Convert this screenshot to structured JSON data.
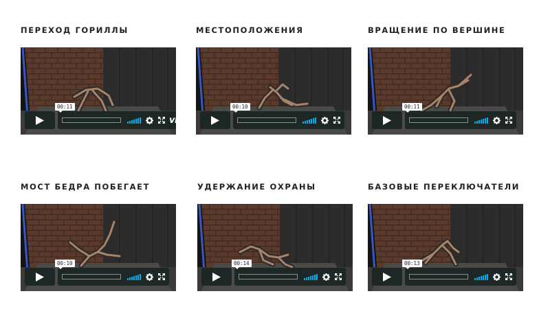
{
  "videos": [
    {
      "title": "ПЕРЕХОД ГОРИЛЛЫ",
      "time": "00:11",
      "brand": "vimeo"
    },
    {
      "title": "МЕСТОПОЛОЖЕНИЯ",
      "time": "00:10"
    },
    {
      "title": "ВРАЩЕНИЕ ПО ВЕРШИНЕ",
      "time": "00:11"
    },
    {
      "title": "МОСТ БЕДРА ПОБЕГАЕТ",
      "time": "00:10"
    },
    {
      "title": "УДЕРЖАНИЕ ОХРАНЫ",
      "time": "00:14"
    },
    {
      "title": "БАЗОВЫЕ ПЕРЕКЛЮЧАТЕЛИ",
      "time": "00:13"
    }
  ],
  "icons": {
    "play": "play-icon",
    "volume": "volume-icon",
    "settings": "gear-icon",
    "fullscreen": "fullscreen-icon"
  },
  "colors": {
    "accent": "#00adef",
    "controls_bg": "#172322",
    "wall": "#5a3a2c",
    "floor": "#3a3a38"
  }
}
